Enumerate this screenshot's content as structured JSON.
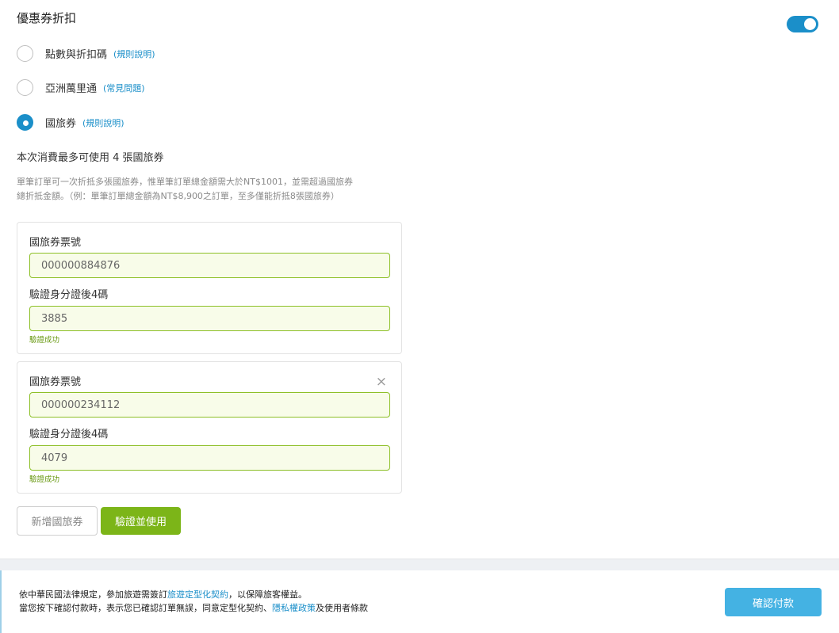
{
  "section": {
    "title": "優惠券折扣",
    "toggle_on": true
  },
  "options": [
    {
      "label": "點數與折扣碼",
      "link": "(規則說明)",
      "checked": false
    },
    {
      "label": "亞洲萬里通",
      "link": "(常見問題)",
      "checked": false
    },
    {
      "label": "國旅券",
      "link": "(規則說明)",
      "checked": true
    }
  ],
  "max_use_text": "本次消費最多可使用 4 張國旅券",
  "description_lines": [
    "單筆訂單可一次折抵多張國旅券，惟單筆訂單總金額需大於NT$1001，並需超過國旅券",
    "總折抵金額。（例：單筆訂單總金額為NT$8,900之訂單，至多僅能折抵8張國旅券）"
  ],
  "vouchers": [
    {
      "number_label": "國旅券票號",
      "number_value": "000000884876",
      "id_label": "驗證身分證後4碼",
      "id_value": "3885",
      "status": "驗證成功"
    },
    {
      "number_label": "國旅券票號",
      "number_value": "000000234112",
      "id_label": "驗證身分證後4碼",
      "id_value": "4079",
      "status": "驗證成功",
      "close_icon": "×"
    }
  ],
  "buttons": {
    "add": "新增國旅券",
    "verify": "驗證並使用"
  },
  "footer": {
    "line1_prefix": "依中華民國法律規定，參加旅遊需簽訂",
    "line1_link": "旅遊定型化契約",
    "line1_suffix": "，以保障旅客權益。",
    "line2_prefix": "當您按下確認付款時，表示您已確認訂單無誤，同意定型化契約、",
    "line2_link": "隱私權政策",
    "line2_suffix": "及使用者條款",
    "pay_button": "確認付款"
  },
  "colors": {
    "accent": "#1b8fc9",
    "success": "#7cb518",
    "pay": "#44b2e3"
  }
}
